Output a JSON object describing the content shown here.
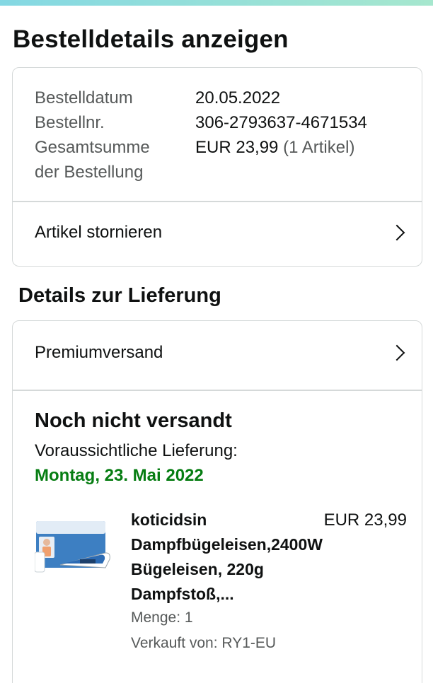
{
  "page": {
    "title": "Bestelldetails anzeigen"
  },
  "order_summary": {
    "date_label": "Bestelldatum",
    "date_value": "20.05.2022",
    "number_label": "Bestellnr.",
    "number_value": "306-2793637-4671534",
    "total_label_line1": "Gesamtsumme",
    "total_label_line2": "der Bestellung",
    "total_value": "EUR 23,99",
    "total_items": "(1 Artikel)",
    "cancel_label": "Artikel stornieren"
  },
  "delivery": {
    "section_title": "Details zur Lieferung",
    "shipping_method": "Premiumversand",
    "status": "Noch nicht versandt",
    "eta_label": "Voraussichtliche Lieferung:",
    "eta_date": "Montag, 23. Mai 2022"
  },
  "product": {
    "name": "koticidsin Dampfbügeleisen,2400W Bügeleisen, 220g Dampfstoß,...",
    "price": "EUR 23,99",
    "quantity": "Menge: 1",
    "seller": "Verkauft von: RY1-EU"
  },
  "colors": {
    "accent_green": "#067d12",
    "border": "#d5d9d9",
    "muted_text": "#565959"
  },
  "icons": {
    "row_chevron": "chevron-right-icon"
  }
}
